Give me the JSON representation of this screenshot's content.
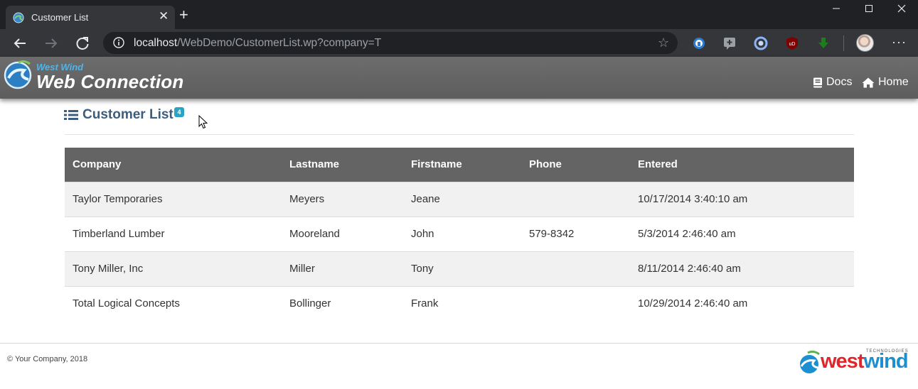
{
  "browser": {
    "tab_title": "Customer List",
    "tab_close": "✕",
    "new_tab": "+",
    "url_host": "localhost",
    "url_path": "/WebDemo/CustomerList.wp?company=T",
    "menu": "···",
    "extensions": [
      "password-manager-icon",
      "feedback-icon",
      "sync-icon",
      "ublock-icon",
      "download-icon"
    ]
  },
  "header": {
    "brand_small": "West Wind",
    "brand_big": "Web Connection",
    "nav": [
      {
        "label": "Docs",
        "icon": "book-icon"
      },
      {
        "label": "Home",
        "icon": "home-icon"
      }
    ]
  },
  "page": {
    "title": "Customer List",
    "count_badge": "4"
  },
  "table": {
    "columns": [
      "Company",
      "Lastname",
      "Firstname",
      "Phone",
      "Entered"
    ],
    "rows": [
      [
        "Taylor Temporaries",
        "Meyers",
        "Jeane",
        "",
        "10/17/2014 3:40:10 am"
      ],
      [
        "Timberland Lumber",
        "Mooreland",
        "John",
        "579-8342",
        "5/3/2014 2:46:40 am"
      ],
      [
        "Tony Miller, Inc",
        "Miller",
        "Tony",
        "",
        "8/11/2014 2:46:40 am"
      ],
      [
        "Total Logical Concepts",
        "Bollinger",
        "Frank",
        "",
        "10/29/2014 2:46:40 am"
      ]
    ]
  },
  "footer": {
    "copyright": "© Your Company, 2018",
    "logo_west": "west",
    "logo_wind": "wind",
    "logo_tech": "TECHNOLOGIES"
  },
  "colors": {
    "accent": "#3d5d7e",
    "badge": "#2ba3c3",
    "header_bg": "#646464"
  }
}
